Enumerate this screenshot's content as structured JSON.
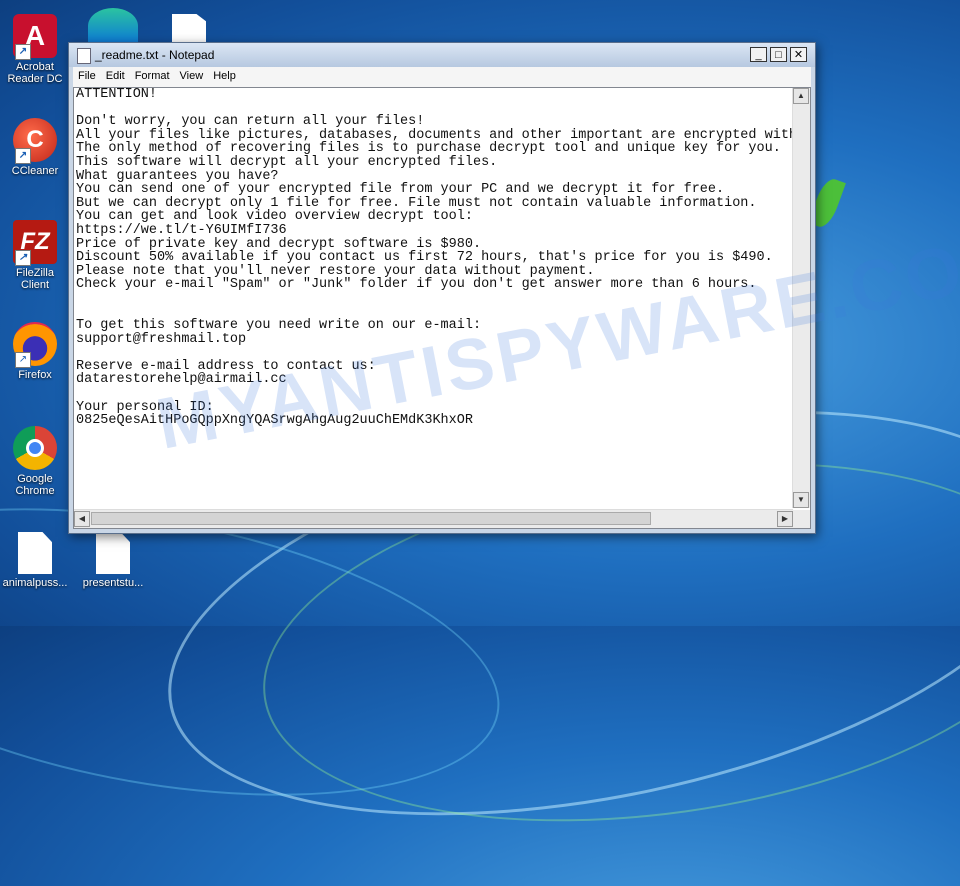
{
  "desktop": {
    "icons": [
      {
        "label": "Acrobat Reader DC",
        "glyph": "A"
      },
      {
        "label": "CCleaner",
        "glyph": "C"
      },
      {
        "label": "FileZilla Client",
        "glyph": "FZ"
      },
      {
        "label": "Firefox"
      },
      {
        "label": "Google Chrome"
      },
      {
        "label": "animalpuss..."
      },
      {
        "label": "presentstu..."
      }
    ],
    "watermark": "MYANTISPYWARE.COM"
  },
  "notepad": {
    "title": "_readme.txt - Notepad",
    "menu": [
      "File",
      "Edit",
      "Format",
      "View",
      "Help"
    ],
    "buttons": {
      "minimize": "_",
      "maximize": "□",
      "close": "✕"
    },
    "content": "ATTENTION!\n\nDon't worry, you can return all your files!\nAll your files like pictures, databases, documents and other important are encrypted with strongest encryption and unique key.\nThe only method of recovering files is to purchase decrypt tool and unique key for you.\nThis software will decrypt all your encrypted files.\nWhat guarantees you have?\nYou can send one of your encrypted file from your PC and we decrypt it for free.\nBut we can decrypt only 1 file for free. File must not contain valuable information.\nYou can get and look video overview decrypt tool:\nhttps://we.tl/t-Y6UIMfI736\nPrice of private key and decrypt software is $980.\nDiscount 50% available if you contact us first 72 hours, that's price for you is $490.\nPlease note that you'll never restore your data without payment.\nCheck your e-mail \"Spam\" or \"Junk\" folder if you don't get answer more than 6 hours.\n\n\nTo get this software you need write on our e-mail:\nsupport@freshmail.top\n\nReserve e-mail address to contact us:\ndatarestorehelp@airmail.cc\n\nYour personal ID:\n0825eQesAitHPoGQppXngYQASrwgAhgAug2uuChEMdK3KhxOR"
  }
}
